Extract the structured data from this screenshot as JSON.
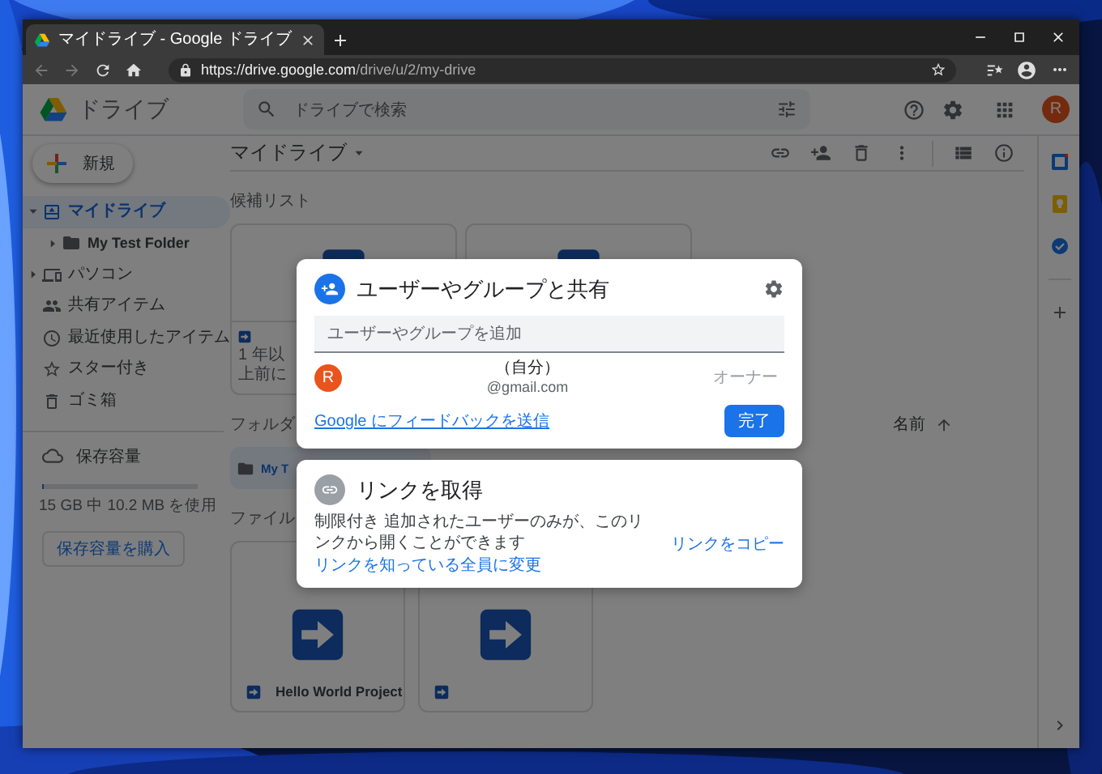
{
  "browser": {
    "tabs": [
      {
        "title": "マイドライブ - Google ドライブ",
        "selected": true
      }
    ],
    "url": {
      "host": "https://drive.google.com",
      "path": "/drive/u/2/my-drive"
    }
  },
  "header": {
    "app_name": "ドライブ",
    "search": {
      "placeholder": "ドライブで検索"
    },
    "avatar": "R"
  },
  "sidebar": {
    "new_button": "新規",
    "items": [
      {
        "label": "マイドライブ",
        "selected": true,
        "expanded": true,
        "children": [
          {
            "label": "My Test Folder",
            "selected": false,
            "expanded": false
          }
        ]
      },
      {
        "label": "パソコン",
        "selected": false,
        "expanded": false
      },
      {
        "label": "共有アイテム",
        "selected": false
      },
      {
        "label": "最近使用したアイテム",
        "selected": false
      },
      {
        "label": "スター付き",
        "selected": false
      },
      {
        "label": "ゴミ箱",
        "selected": false
      }
    ],
    "storage": {
      "label": "保存容量",
      "level": 0.001,
      "usage": "15 GB 中 10.2 MB を使用",
      "buy_button": "保存容量を購入"
    }
  },
  "main": {
    "title": "マイドライブ",
    "suggested": {
      "heading": "候補リスト",
      "cards": [
        {
          "kind": "file",
          "caption": "1 年以上前に"
        },
        {
          "kind": "file"
        }
      ]
    },
    "folders": {
      "heading": "フォルダ",
      "sort": {
        "label": "名前",
        "ascending": true
      },
      "items": [
        {
          "name": "My T",
          "selected": true
        }
      ]
    },
    "files": {
      "heading": "ファイル",
      "items": [
        {
          "kind": "file",
          "name": "Hello World Project"
        },
        {
          "kind": "file"
        }
      ]
    }
  },
  "share_dialog": {
    "title": "ユーザーやグループと共有",
    "input": {
      "placeholder": "ユーザーやグループを追加"
    },
    "people": [
      {
        "avatar": "R",
        "name": "（自分）",
        "email": "@gmail.com",
        "role": "オーナー"
      }
    ],
    "feedback_link": "Google にフィードバックを送信",
    "done_button": "完了"
  },
  "link_dialog": {
    "title": "リンクを取得",
    "description": "制限付き 追加されたユーザーのみが、このリンクから開くことができます",
    "change_link": "リンクを知っている全員に変更",
    "copy_link": "リンクをコピー"
  }
}
